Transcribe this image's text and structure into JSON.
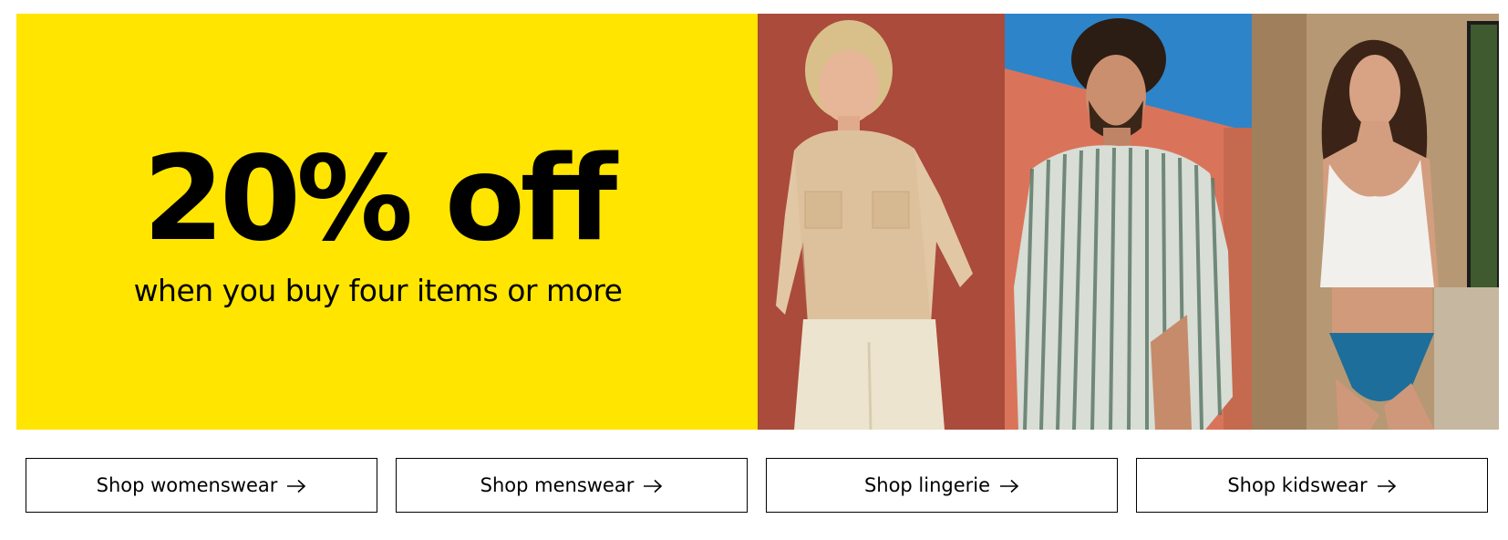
{
  "promo": {
    "headline": "20% off",
    "subline": "when you buy four items or more",
    "background_color": "#ffe500"
  },
  "photos": [
    {
      "subject": "woman in sequin beige shirt and cream trousers against red wall",
      "bg_color": "#b5523f"
    },
    {
      "subject": "man in green striped linen shirt against blue sky and terracotta wall",
      "bg_color": "#d27a5c"
    },
    {
      "subject": "woman in white vest and blue lace briefs in tan room",
      "bg_color": "#b99a78"
    }
  ],
  "buttons": [
    {
      "label": "Shop womenswear",
      "icon": "arrow-right-icon"
    },
    {
      "label": "Shop menswear",
      "icon": "arrow-right-icon"
    },
    {
      "label": "Shop lingerie",
      "icon": "arrow-right-icon"
    },
    {
      "label": "Shop kidswear",
      "icon": "arrow-right-icon"
    }
  ]
}
